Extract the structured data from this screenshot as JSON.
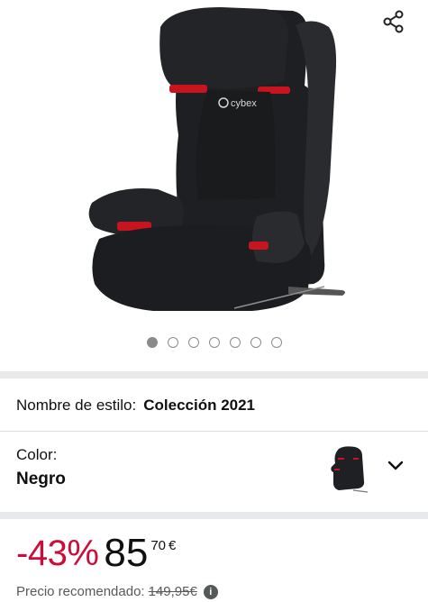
{
  "product": {
    "image_alt": "cybex",
    "image_count": 7,
    "active_image_index": 0
  },
  "style": {
    "label": "Nombre de estilo:",
    "value": "Colección 2021"
  },
  "color": {
    "label": "Color:",
    "value": "Negro"
  },
  "price": {
    "discount": "-43%",
    "whole": "85",
    "fraction": "70",
    "currency": "€"
  },
  "rrp": {
    "label": "Precio recomendado:",
    "value": "149,95€",
    "info_glyph": "i"
  },
  "icons": {
    "share": "share-icon",
    "chevron": "chevron-down-icon",
    "info": "info-icon"
  },
  "colors": {
    "discount": "#cc0c39",
    "text": "#0f1111",
    "muted": "#565959",
    "divider": "#e8e9ea"
  }
}
